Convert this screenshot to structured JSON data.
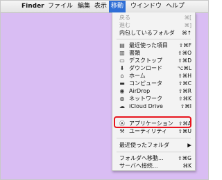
{
  "menubar": {
    "apple": "",
    "app": "Finder",
    "file": "ファイル",
    "edit": "編集",
    "view": "表示",
    "go": "移動",
    "window": "ウインドウ",
    "help": "ヘルプ"
  },
  "menu": {
    "back": {
      "label": "戻る",
      "shortcut": "⌘["
    },
    "forward": {
      "label": "進む",
      "shortcut": "⌘]"
    },
    "enclosing": {
      "label": "内包しているフォルダ",
      "shortcut": "⌘↑"
    },
    "recents": {
      "label": "最近使った項目",
      "shortcut": "⇧⌘F",
      "icon": "▤"
    },
    "documents": {
      "label": "書類",
      "shortcut": "⇧⌘O",
      "icon": "▥"
    },
    "desktop": {
      "label": "デスクトップ",
      "shortcut": "⇧⌘D",
      "icon": "▭"
    },
    "downloads": {
      "label": "ダウンロード",
      "shortcut": "⌥⌘L",
      "icon": "⬇"
    },
    "home": {
      "label": "ホーム",
      "shortcut": "⇧⌘H",
      "icon": "⌂"
    },
    "computer": {
      "label": "コンピュータ",
      "shortcut": "⇧⌘C",
      "icon": "▬"
    },
    "airdrop": {
      "label": "AirDrop",
      "shortcut": "⇧⌘R",
      "icon": "◉"
    },
    "network": {
      "label": "ネットワーク",
      "shortcut": "⇧⌘K",
      "icon": "◍"
    },
    "icloud": {
      "label": "iCloud Drive",
      "shortcut": "⇧⌘I",
      "icon": "☁"
    },
    "applications": {
      "label": "アプリケーション",
      "shortcut": "⇧⌘A",
      "icon": "Ⓐ"
    },
    "utilities": {
      "label": "ユーティリティ",
      "shortcut": "⇧⌘U",
      "icon": "⚒"
    },
    "recent_folders": {
      "label": "最近使ったフォルダ",
      "shortcut": "▶"
    },
    "goto_folder": {
      "label": "フォルダへ移動...",
      "shortcut": "⇧⌘G"
    },
    "connect_server": {
      "label": "サーバへ接続...",
      "shortcut": "⌘K"
    }
  },
  "colors": {
    "desktop": "#d9bdf3",
    "menu_selected": "#2f6fd6",
    "highlight_box": "#e8141e"
  }
}
